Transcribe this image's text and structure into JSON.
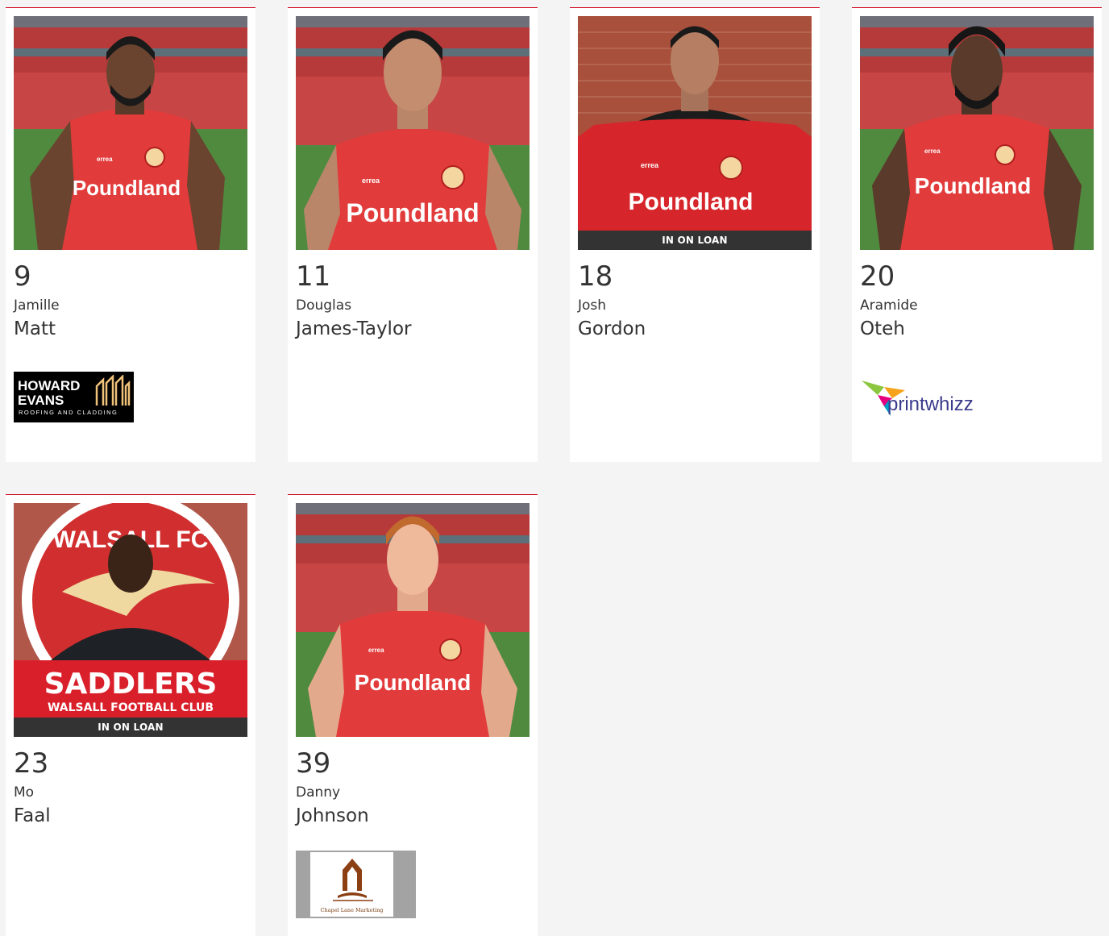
{
  "players": [
    {
      "number": "9",
      "first_name": "Jamille",
      "last_name": "Matt",
      "on_loan": "",
      "sponsor": {
        "name": "Howard Evans",
        "line1": "HOWARD",
        "line2": "EVANS",
        "line3": "ROOFING AND CLADDING"
      }
    },
    {
      "number": "11",
      "first_name": "Douglas",
      "last_name": "James-Taylor",
      "on_loan": "",
      "sponsor": null
    },
    {
      "number": "18",
      "first_name": "Josh",
      "last_name": "Gordon",
      "on_loan": "IN ON LOAN",
      "sponsor": null
    },
    {
      "number": "20",
      "first_name": "Aramide",
      "last_name": "Oteh",
      "on_loan": "",
      "sponsor": {
        "name": "printwhizz",
        "text": "printwhizz"
      }
    },
    {
      "number": "23",
      "first_name": "Mo",
      "last_name": "Faal",
      "on_loan": "IN ON LOAN",
      "sponsor": null
    },
    {
      "number": "39",
      "first_name": "Danny",
      "last_name": "Johnson",
      "on_loan": "",
      "sponsor": {
        "name": "Chapel Lane Marketing",
        "text": "Chapel Lane Marketing"
      }
    }
  ],
  "shirt_text": "Poundland",
  "kit_brand": "errea",
  "club_sign": {
    "line1": "WALSALL FC",
    "scarf_line1": "SADDLERS",
    "scarf_line2": "WALSALL FOOTBALL CLUB"
  },
  "colors": {
    "accent": "#d0011b",
    "kit_red": "#e23b3b",
    "background": "#f4f4f4",
    "card": "#ffffff",
    "loan_bar": "#333333"
  }
}
